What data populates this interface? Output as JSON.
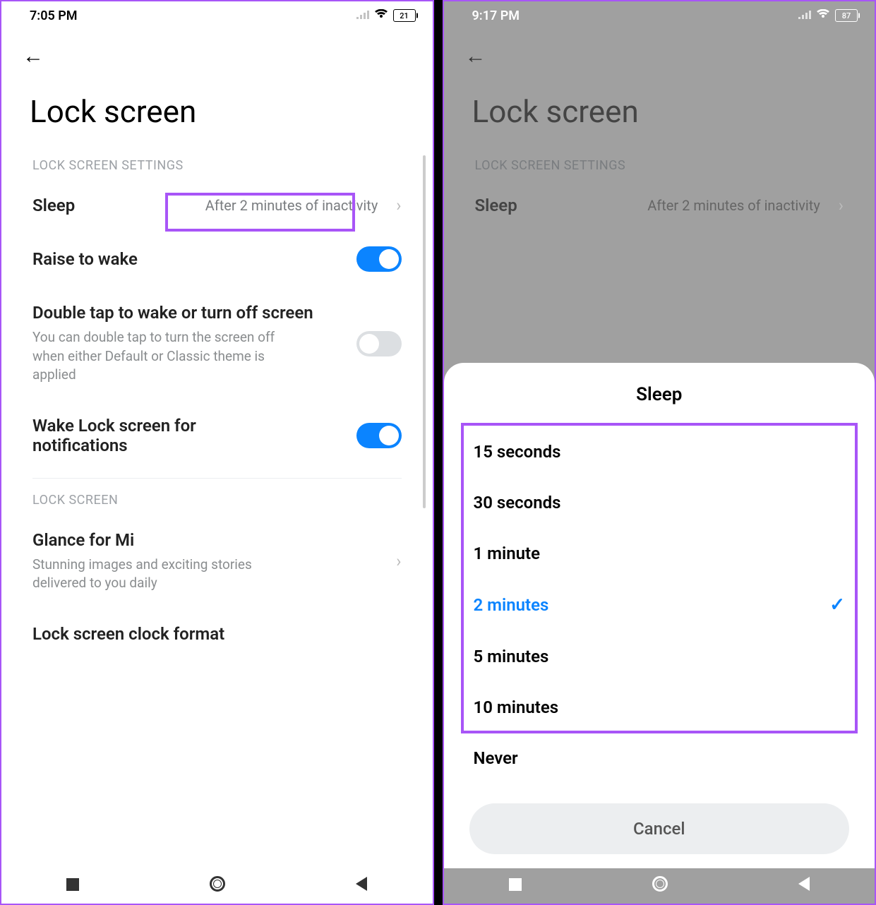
{
  "left": {
    "status": {
      "time": "7:05 PM",
      "battery": "21"
    },
    "title": "Lock screen",
    "section1": "LOCK SCREEN SETTINGS",
    "sleep": {
      "label": "Sleep",
      "value": "After 2 minutes of inactivity"
    },
    "raise": {
      "label": "Raise to wake"
    },
    "doubletap": {
      "label": "Double tap to wake or turn off screen",
      "desc": "You can double tap to turn the screen off when either Default or Classic theme is applied"
    },
    "wakelock": {
      "label": "Wake Lock screen for notifications"
    },
    "section2": "LOCK SCREEN",
    "glance": {
      "label": "Glance for Mi",
      "desc": "Stunning images and exciting stories delivered to you daily"
    },
    "clockformat": {
      "label": "Lock screen clock format"
    }
  },
  "right": {
    "status": {
      "time": "9:17 PM",
      "battery": "87"
    },
    "title": "Lock screen",
    "section1": "LOCK SCREEN SETTINGS",
    "sleep": {
      "label": "Sleep",
      "value": "After 2 minutes of inactivity"
    },
    "sheet": {
      "title": "Sleep",
      "options": [
        "15 seconds",
        "30 seconds",
        "1 minute",
        "2 minutes",
        "5 minutes",
        "10 minutes",
        "Never"
      ],
      "selected_index": 3,
      "cancel": "Cancel"
    }
  }
}
